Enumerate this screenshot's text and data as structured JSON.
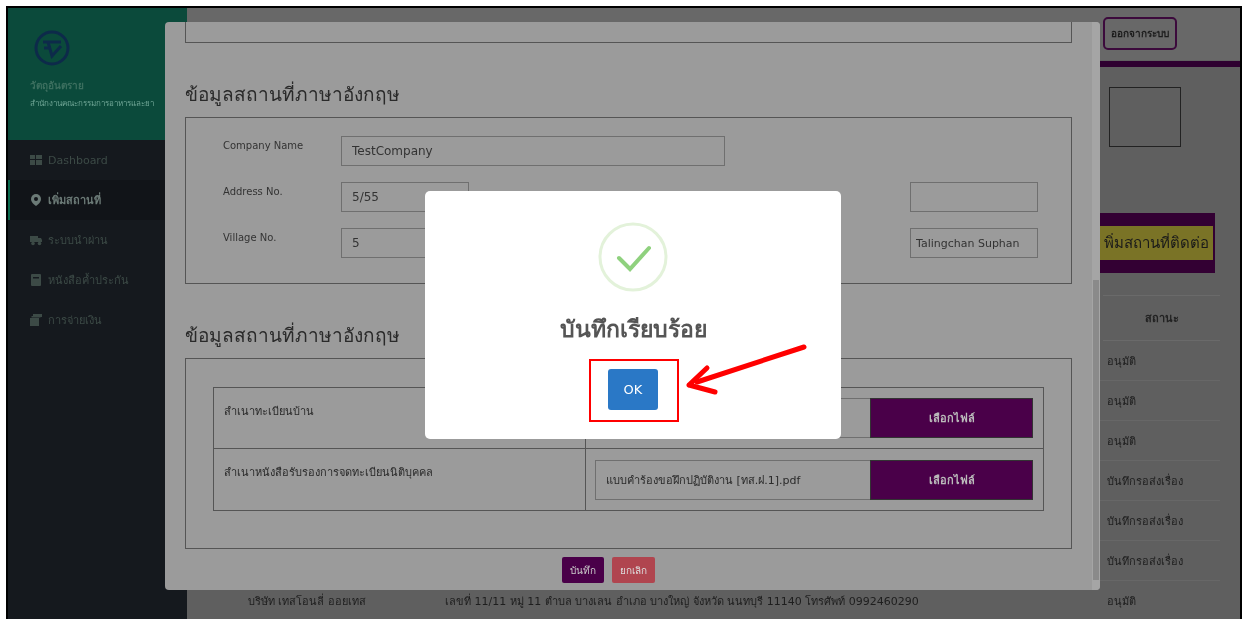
{
  "sidebar": {
    "title": "วัตถุอันตราย",
    "subtitle": "สำนักงานคณะกรรมการอาหารและยา",
    "items": [
      {
        "label": "Dashboard",
        "selected": false
      },
      {
        "label": "เพิ่มสถานที่",
        "selected": true
      },
      {
        "label": "ระบบนำผ่าน",
        "selected": false
      },
      {
        "label": "หนังสือค้ำประกัน",
        "selected": false
      },
      {
        "label": "การจ่ายเงิน",
        "selected": false
      }
    ]
  },
  "header": {
    "logout_button": "ออกจากระบบ"
  },
  "page": {
    "add_button": "พิ่มสถานที่ติดต่อ",
    "table": {
      "columns": [
        "สถานะ"
      ],
      "rows": [
        {
          "status": "อนุมัติ"
        },
        {
          "status": "อนุมัติ"
        },
        {
          "status": "อนุมัติ"
        },
        {
          "status": "บันทึกรอส่งเรื่อง"
        },
        {
          "status": "บันทึกรอส่งเรื่อง"
        },
        {
          "status": "บันทึกรอส่งเรื่อง"
        },
        {
          "column_1": "บริษัท เทสโอนลี่ ออยเทส",
          "column_2": "เลขที่ 11/11 หมู่ 11 ตำบล บางเลน อำเภอ บางใหญ่ จังหวัด นนทบุรี 11140 โทรศัพท์ 0992460290",
          "status": "อนุมัติ"
        }
      ]
    }
  },
  "modal": {
    "sections": [
      {
        "title": "ข้อมูลสถานที่ภาษาอังกฤษ",
        "rows": [
          [
            {
              "label": "Company Name",
              "value": "TestCompany"
            }
          ],
          [
            {
              "label": "Address No.",
              "value": "5/55"
            },
            {}
          ],
          [
            {
              "label": "Village No.",
              "value": "5"
            },
            {
              "value": "Talingchan Suphan"
            }
          ]
        ]
      },
      {
        "title": "ข้อมูลสถานที่ภาษาอังกฤษ",
        "files": [
          {
            "label": "สำเนาทะเบียนบ้าน",
            "button": "เลือกไฟล์"
          },
          {
            "label": "สำเนาหนังสือรับรองการจดทะเบียนนิติบุคคล",
            "file": "แบบคำร้องขอฝึกปฏิบัติงาน [ทส.ฝ.1].pdf",
            "button": "เลือกไฟล์"
          }
        ]
      }
    ],
    "buttons": [
      {
        "label": "บันทึก",
        "kind": "primary"
      },
      {
        "label": "ยกเลิก",
        "kind": "danger"
      }
    ]
  },
  "alert": {
    "title": "บันทึกเรียบร้อย",
    "button": "OK"
  }
}
